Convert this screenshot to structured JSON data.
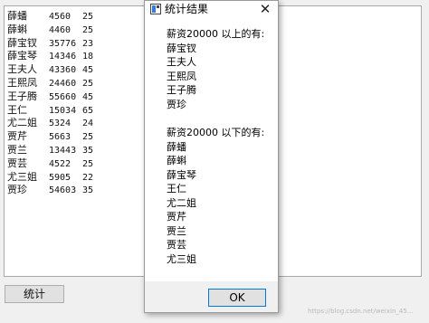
{
  "main": {
    "records": [
      {
        "name": "薛蟠",
        "salary": "4560",
        "age": "25"
      },
      {
        "name": "薛蝌",
        "salary": "4460",
        "age": "25"
      },
      {
        "name": "薛宝钗",
        "salary": "35776",
        "age": "23"
      },
      {
        "name": "薛宝琴",
        "salary": "14346",
        "age": "18"
      },
      {
        "name": "王夫人",
        "salary": "43360",
        "age": "45"
      },
      {
        "name": "王熙凤",
        "salary": "24460",
        "age": "25"
      },
      {
        "name": "王子腾",
        "salary": "55660",
        "age": "45"
      },
      {
        "name": "王仁",
        "salary": "15034",
        "age": "65"
      },
      {
        "name": "尤二姐",
        "salary": "5324",
        "age": "24"
      },
      {
        "name": "贾芹",
        "salary": "5663",
        "age": "25"
      },
      {
        "name": "贾兰",
        "salary": "13443",
        "age": "35"
      },
      {
        "name": "贾芸",
        "salary": "4522",
        "age": "25"
      },
      {
        "name": "尤三姐",
        "salary": "5905",
        "age": "22"
      },
      {
        "name": "贾珍",
        "salary": "54603",
        "age": "35"
      }
    ],
    "stat_button_label": "统计"
  },
  "dialog": {
    "title": "统计结果",
    "close_glyph": "✕",
    "above_heading": "薪资20000 以上的有:",
    "above_names": [
      "薛宝钗",
      "王夫人",
      "王熙凤",
      "王子腾",
      "贾珍"
    ],
    "below_heading": "薪资20000 以下的有:",
    "below_names": [
      "薛蟠",
      "薛蝌",
      "薛宝琴",
      "王仁",
      "尤二姐",
      "贾芹",
      "贾兰",
      "贾芸",
      "尤三姐"
    ],
    "ok_label": "OK"
  },
  "watermark": "https://blog.csdn.net/weixin_45..."
}
